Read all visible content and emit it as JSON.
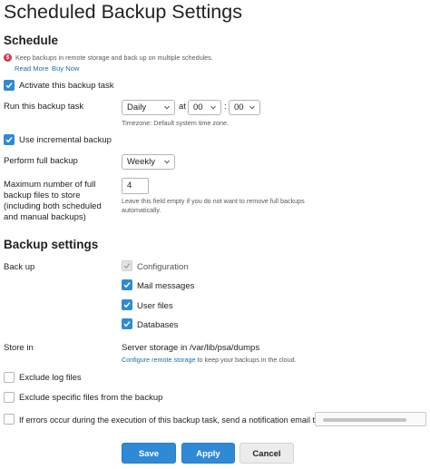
{
  "page": {
    "title": "Scheduled Backup Settings"
  },
  "schedule": {
    "heading": "Schedule",
    "badge_letter": "$",
    "upsell_text": "Keep backups in remote storage and back up on multiple schedules.",
    "read_more": "Read More",
    "buy_now": "Buy Now",
    "activate_label": "Activate this backup task",
    "activate_checked": true,
    "run_label": "Run this backup task",
    "frequency": "Daily",
    "at_label": "at",
    "hour": "00",
    "colon": ":",
    "minute": "00",
    "timezone_hint": "Timezone: Default system time zone.",
    "incremental_label": "Use incremental backup",
    "incremental_checked": true,
    "full_backup_label": "Perform full backup",
    "full_backup_value": "Weekly",
    "max_files_label": "Maximum number of full backup files to store (including both scheduled and manual backups)",
    "max_files_value": "4",
    "max_files_hint": "Leave this field empty if you do not want to remove full backups automatically."
  },
  "backup_settings": {
    "heading": "Backup settings",
    "backup_up_label": "Back up",
    "items": [
      {
        "label": "Configuration",
        "checked": true,
        "disabled": true
      },
      {
        "label": "Mail messages",
        "checked": true,
        "disabled": false
      },
      {
        "label": "User files",
        "checked": true,
        "disabled": false
      },
      {
        "label": "Databases",
        "checked": true,
        "disabled": false
      }
    ],
    "store_in_label": "Store in",
    "store_in_value": "Server storage in /var/lib/psa/dumps",
    "configure_link": "Configure remote storage",
    "configure_rest": " to keep your backups in the cloud.",
    "exclude_logs_label": "Exclude log files",
    "exclude_specific_label": "Exclude specific files from the backup",
    "notify_label": "If errors occur during the execution of this backup task, send a notification email to"
  },
  "buttons": {
    "save": "Save",
    "apply": "Apply",
    "cancel": "Cancel"
  },
  "colors": {
    "accent": "#2f8ad6",
    "link": "#1a6fb3",
    "badge": "#d63447"
  }
}
